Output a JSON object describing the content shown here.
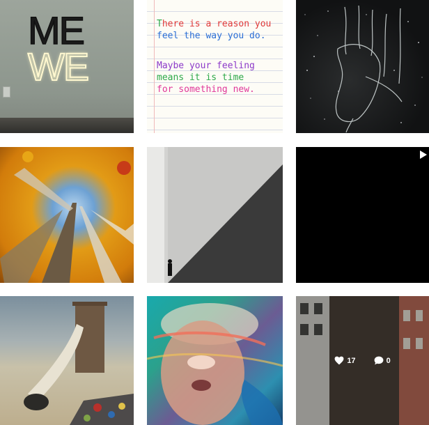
{
  "tiles": [
    {
      "name": "mewe-sign",
      "sign_line1": "ME",
      "sign_line2": "WE"
    },
    {
      "name": "reason-note",
      "note_lines": [
        "There is a reason you",
        "feel the way you do.",
        "",
        "Maybe your feeling",
        "means it is time",
        "for something new."
      ]
    },
    {
      "name": "galaxy-figure"
    },
    {
      "name": "aspen-forest"
    },
    {
      "name": "shadow-architecture"
    },
    {
      "name": "black-video",
      "icon": "play-icon"
    },
    {
      "name": "surreal-desert"
    },
    {
      "name": "painted-face"
    },
    {
      "name": "chairs-building",
      "likes": "17",
      "comments": "0",
      "icons": [
        "heart-icon",
        "comment-icon"
      ]
    }
  ],
  "colors": {
    "background": "#ffffff",
    "overlay": "rgba(0,0,0,0.3)"
  }
}
